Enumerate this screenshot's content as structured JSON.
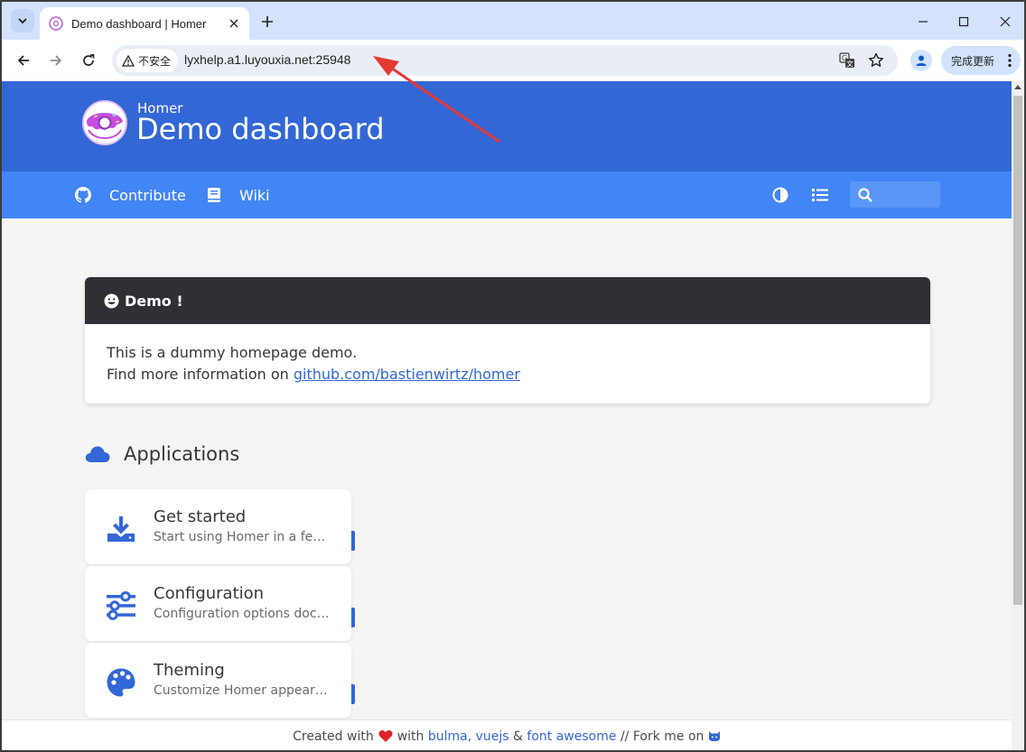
{
  "browser": {
    "tab_title": "Demo dashboard | Homer",
    "security_label": "不安全",
    "url": "lyxhelp.a1.luyouxia.net:25948",
    "update_button": "完成更新"
  },
  "hero": {
    "subtitle": "Homer",
    "title": "Demo dashboard"
  },
  "navbar": {
    "links": [
      {
        "label": "Contribute",
        "icon": "github-icon"
      },
      {
        "label": "Wiki",
        "icon": "book-icon"
      }
    ],
    "search_placeholder": ""
  },
  "message": {
    "title": "Demo !",
    "line1": "This is a dummy homepage demo.",
    "line2_prefix": "Find more information on ",
    "link_text": "github.com/bastienwirtz/homer"
  },
  "applications": {
    "title": "Applications",
    "cards": [
      {
        "title": "Get started",
        "subtitle": "Start using Homer in a few minutes",
        "icon": "download-icon"
      },
      {
        "title": "Configuration",
        "subtitle": "Configuration options documentation",
        "icon": "sliders-icon"
      },
      {
        "title": "Theming",
        "subtitle": "Customize Homer appearance",
        "icon": "palette-icon"
      }
    ]
  },
  "footer": {
    "created_with": "Created with",
    "with": "with",
    "bulma_vuejs": "bulma, vuejs",
    "amp": "&",
    "font_awesome": "font awesome",
    "fork": "// Fork me on"
  },
  "colors": {
    "hero": "#3367d6",
    "navbar": "#4285f4",
    "message_header": "#2f3035",
    "accent": "#3367d6"
  }
}
